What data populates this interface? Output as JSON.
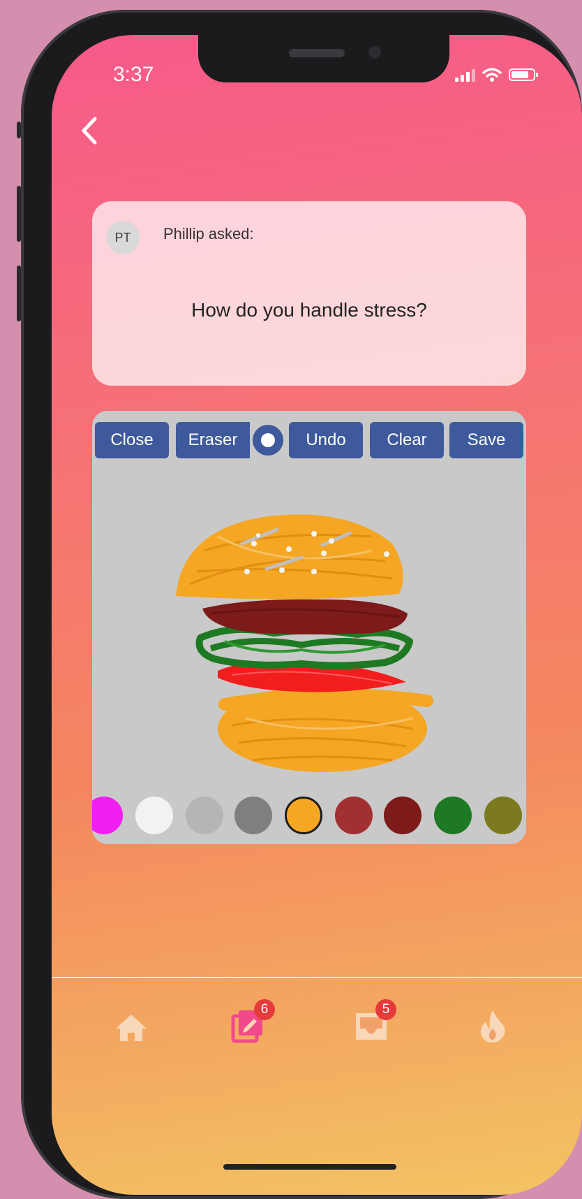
{
  "status_bar": {
    "time": "3:37"
  },
  "prompt_card": {
    "avatar_initials": "PT",
    "asker": "Phillip asked:",
    "question": "How do you handle stress?"
  },
  "toolbar": {
    "close_label": "Close",
    "eraser_label": "Eraser",
    "undo_label": "Undo",
    "clear_label": "Clear",
    "save_label": "Save"
  },
  "palette": {
    "colors": [
      "#f21ff2",
      "#f2f2f2",
      "#b5b5b5",
      "#7f7f7f",
      "#f5a623",
      "#a33030",
      "#7d1a1a",
      "#1e7a22",
      "#7c7a20"
    ],
    "selected": "#f5a623"
  },
  "tabbar": {
    "items": [
      {
        "icon": "home-icon"
      },
      {
        "icon": "drawing-cards-icon",
        "badge": "6"
      },
      {
        "icon": "inbox-icon",
        "badge": "5"
      },
      {
        "icon": "flame-icon"
      }
    ]
  }
}
